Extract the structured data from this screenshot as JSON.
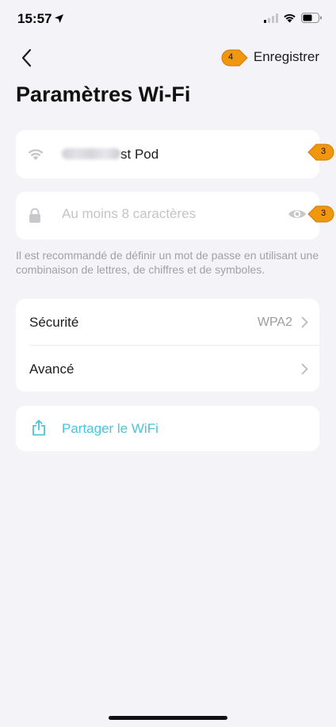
{
  "status_bar": {
    "time": "15:57"
  },
  "header": {
    "save_label": "Enregistrer",
    "save_badge": "4"
  },
  "page": {
    "title": "Paramètres Wi-Fi"
  },
  "ssid": {
    "visible_text": "st Pod",
    "badge": "3"
  },
  "password": {
    "placeholder": "Au moins 8 caractères",
    "value": "",
    "badge": "3"
  },
  "hint": "Il est recommandé de définir un mot de passe en utilisant une combinaison de lettres, de chiffres et de symboles.",
  "settings": {
    "security_label": "Sécurité",
    "security_value": "WPA2",
    "advanced_label": "Avancé"
  },
  "share": {
    "label": "Partager le WiFi"
  },
  "colors": {
    "background": "#f4f4f8",
    "accent": "#4bc3da",
    "badge": "#f0960f"
  }
}
